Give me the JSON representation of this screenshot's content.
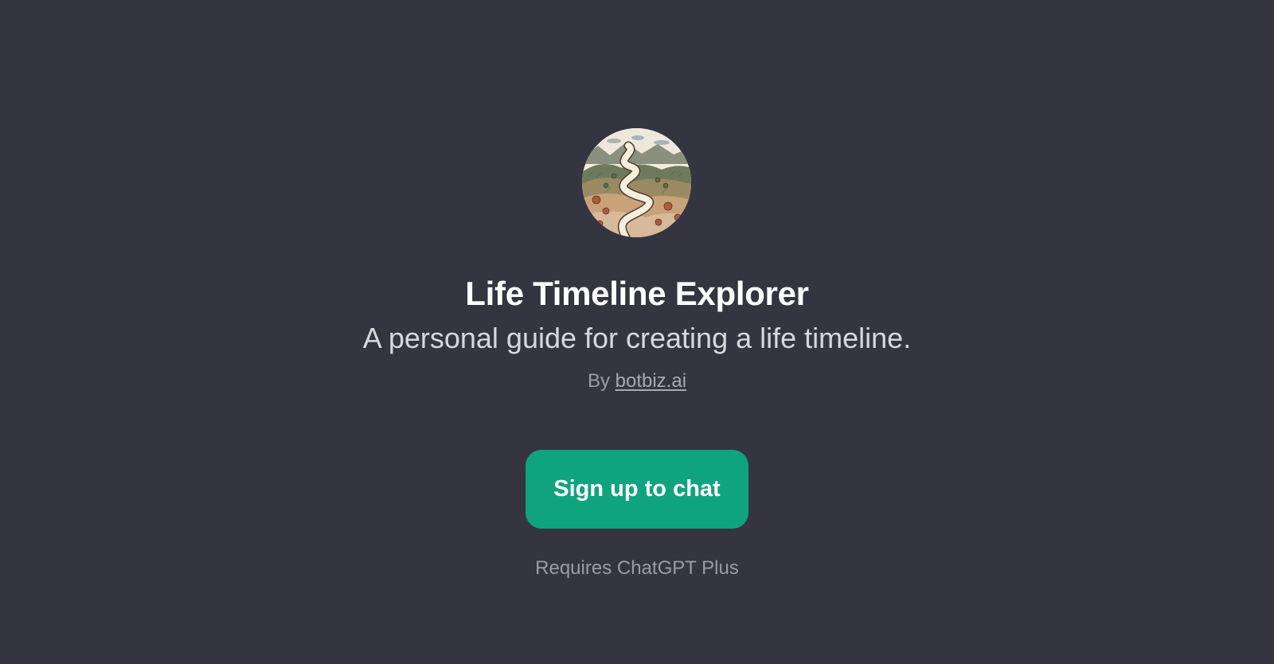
{
  "gpt": {
    "avatar_icon": "winding-road-landscape-icon",
    "title": "Life Timeline Explorer",
    "description": "A personal guide for creating a life timeline.",
    "by_prefix": "By",
    "author": "botbiz.ai"
  },
  "cta": {
    "label": "Sign up to chat",
    "color": "#10a37f"
  },
  "requirement": "Requires ChatGPT Plus",
  "theme": {
    "background": "#343541",
    "title_color": "#ffffff",
    "muted_text": "#9b9ba6"
  }
}
